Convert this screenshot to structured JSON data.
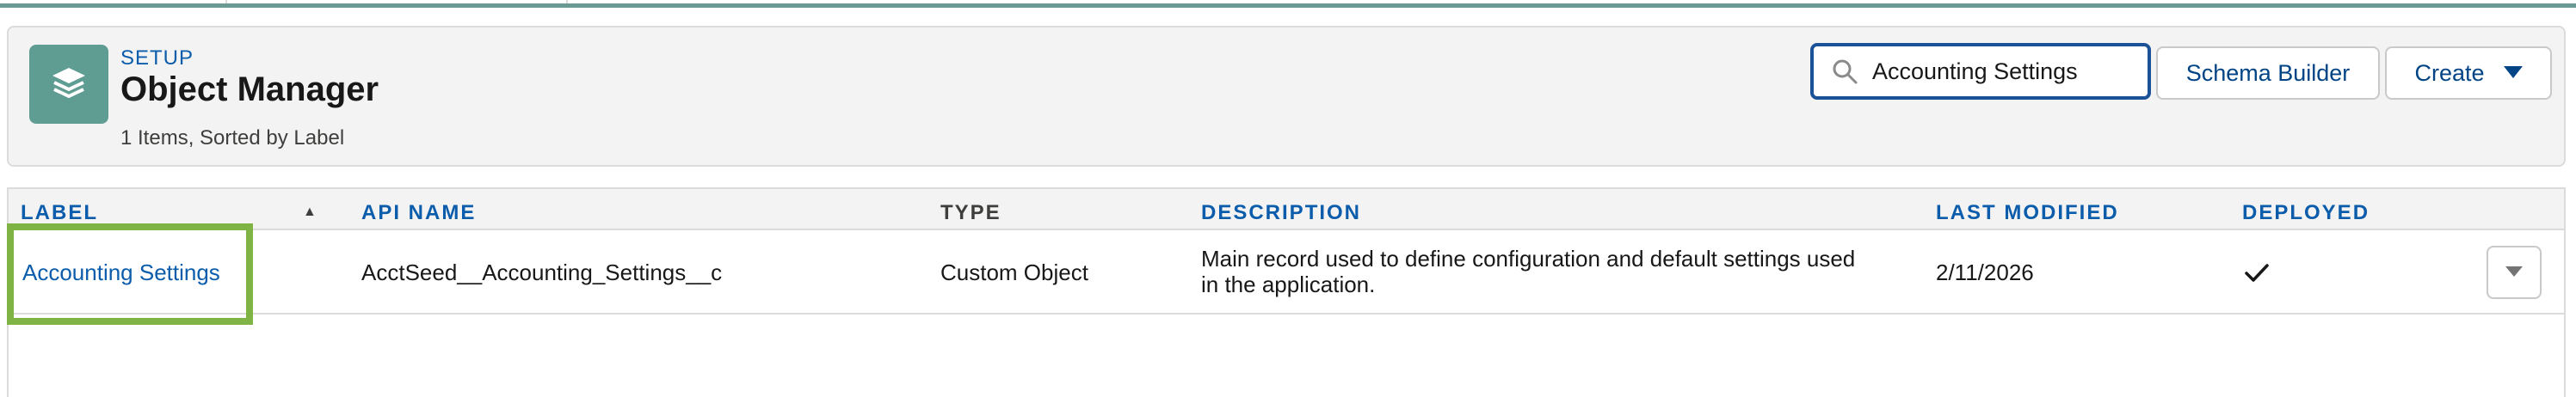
{
  "header": {
    "setup_label": "SETUP",
    "title": "Object Manager",
    "subtitle": "1 Items, Sorted by Label",
    "icon": "layers-icon",
    "icon_color": "#5f9c92"
  },
  "search": {
    "value": "Accounting Settings",
    "icon": "search-icon"
  },
  "buttons": {
    "schema_builder": "Schema Builder",
    "create": "Create"
  },
  "table": {
    "columns": [
      "LABEL",
      "API NAME",
      "TYPE",
      "DESCRIPTION",
      "LAST MODIFIED",
      "DEPLOYED"
    ],
    "sort_column": "LABEL",
    "sort_direction": "ascending",
    "rows": [
      {
        "label": "Accounting Settings",
        "api_name": "AcctSeed__Accounting_Settings__c",
        "type": "Custom Object",
        "description_line1": "Main record used to define configuration and default settings used",
        "description_line2": "in the application.",
        "last_modified": "2/11/2026",
        "deployed": true
      }
    ]
  },
  "colors": {
    "accent": "#0b5cab",
    "highlight": "#7fb344",
    "brand": "#6a9a93"
  }
}
